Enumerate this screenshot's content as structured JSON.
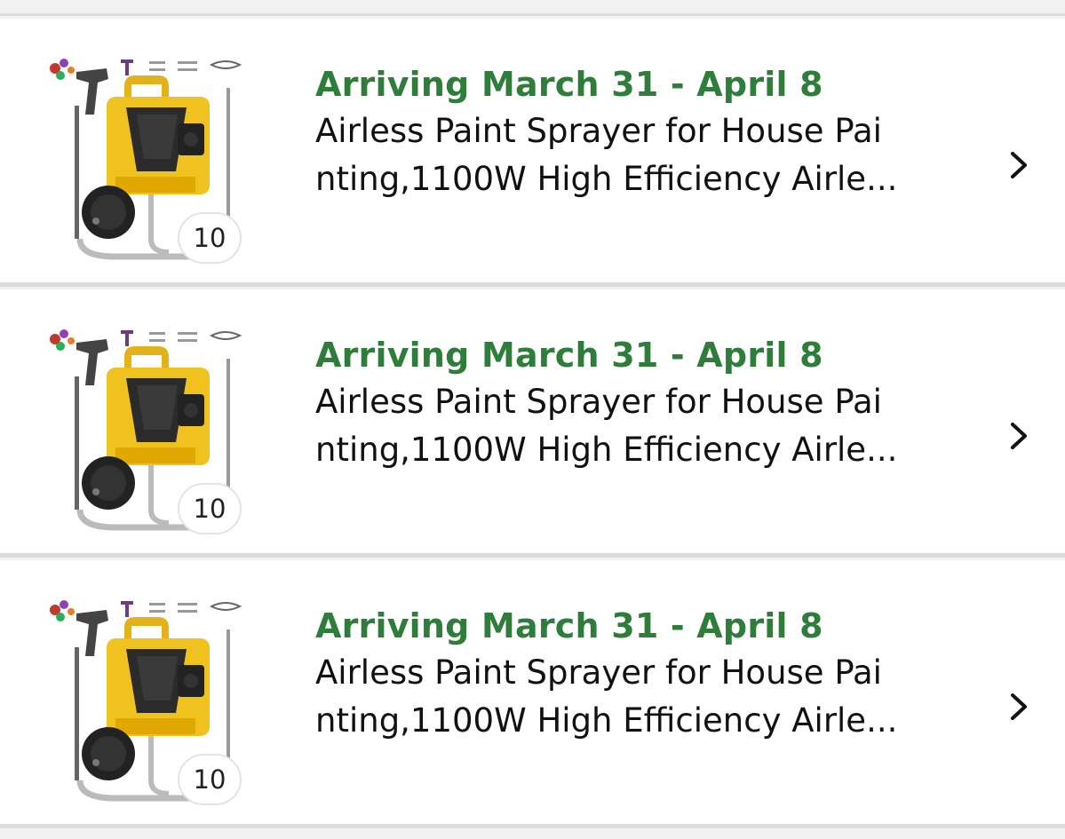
{
  "orders": [
    {
      "delivery": "Arriving March 31 - April 8",
      "title_line1": "Airless Paint Sprayer for House Pai",
      "title_line2": "nting,1100W High Efficiency Airle...",
      "quantity": "10",
      "thumbnail": "paint-sprayer-product-image"
    },
    {
      "delivery": "Arriving March 31 - April 8",
      "title_line1": "Airless Paint Sprayer for House Pai",
      "title_line2": "nting,1100W High Efficiency Airle...",
      "quantity": "10",
      "thumbnail": "paint-sprayer-product-image"
    },
    {
      "delivery": "Arriving March 31 - April 8",
      "title_line1": "Airless Paint Sprayer for House Pai",
      "title_line2": "nting,1100W High Efficiency Airle...",
      "quantity": "10",
      "thumbnail": "paint-sprayer-product-image"
    }
  ],
  "colors": {
    "delivery_green": "#2e7d3a",
    "divider": "#dcdcdc",
    "background": "#f2f2f2"
  },
  "icons": {
    "chevron": "chevron-right-icon"
  }
}
